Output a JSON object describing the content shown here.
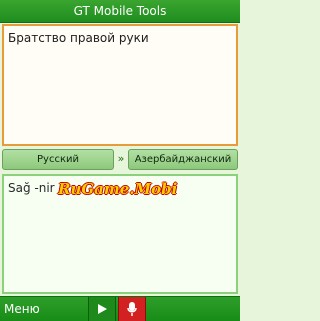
{
  "title": "GT Mobile Tools",
  "source_text": "Братство правой руки",
  "languages": {
    "source": "Русский",
    "swap_symbol": "»",
    "target": "Азербайджанский"
  },
  "translation": {
    "text": "Sağ -nir"
  },
  "watermark": "RuGame.Mobi",
  "bottom_bar": {
    "menu_label": "Меню",
    "play_icon": "play-icon",
    "mic_icon": "microphone-icon"
  },
  "colors": {
    "title_bar": "#2a9a25",
    "source_border": "#e89b3a",
    "target_border": "#8bd07b",
    "language_button": "#a2d592",
    "mic_button": "#d32020"
  }
}
